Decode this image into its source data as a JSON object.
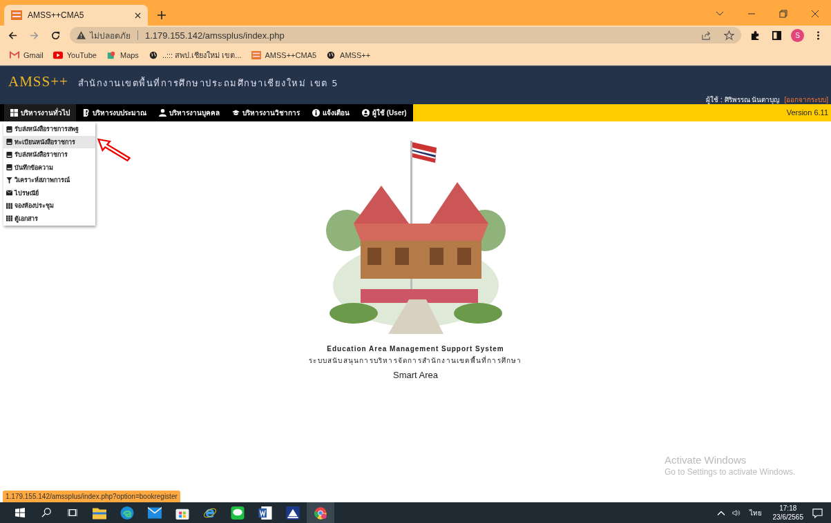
{
  "browser": {
    "tabs": [
      {
        "title": "AMSS++CMA5",
        "selected": true
      }
    ],
    "address": {
      "security": "ไม่ปลอดภัย",
      "url": "1.179.155.142/amssplus/index.php"
    },
    "profile_initial": "S",
    "bookmarks": [
      {
        "kind": "gmail",
        "label": "Gmail"
      },
      {
        "kind": "youtube",
        "label": "YouTube"
      },
      {
        "kind": "maps",
        "label": "Maps"
      },
      {
        "kind": "globe",
        "label": "..::: สพป.เชียงใหม่ เขต..."
      },
      {
        "kind": "amss",
        "label": "AMSS++CMA5"
      },
      {
        "kind": "globe",
        "label": "AMSS++"
      }
    ]
  },
  "header": {
    "logo": "AMSS++",
    "org": "สำนักงานเขตพื้นที่การศึกษาประถมศึกษาเชียงใหม่ เขต 5",
    "user_label": "ผู้ใช้ : ศิริพรรณ นันตาบุญ",
    "logout": "[ออกจากระบบ]"
  },
  "nav": {
    "items": [
      {
        "kind": "grid",
        "label": "บริหารงานทั่วไป",
        "selected": true
      },
      {
        "kind": "bitcoin",
        "label": "บริหารงบประมาณ",
        "selected": false
      },
      {
        "kind": "user",
        "label": "บริหารงานบุคคล",
        "selected": false
      },
      {
        "kind": "cap",
        "label": "บริหารงานวิชาการ",
        "selected": false
      },
      {
        "kind": "info",
        "label": "แจ้งเตือน",
        "selected": false
      },
      {
        "kind": "usercircle",
        "label": "ผู้ใช้ (User)",
        "selected": false
      }
    ],
    "version": "Version 6.11"
  },
  "dropdown": [
    {
      "kind": "book",
      "label": "รับส่งหนังสือราชการสพฐ",
      "selected": false
    },
    {
      "kind": "book",
      "label": "ทะเบียนหนังสือราชการ",
      "selected": true
    },
    {
      "kind": "book",
      "label": "รับส่งหนังสือราชการ",
      "selected": false
    },
    {
      "kind": "book",
      "label": "บันทึกข้อความ",
      "selected": false
    },
    {
      "kind": "filter",
      "label": "วิเคราะห์สภาพการณ์",
      "selected": false
    },
    {
      "kind": "mail",
      "label": "ไปรษณีย์",
      "selected": false
    },
    {
      "kind": "grid",
      "label": "จองห้องประชุม",
      "selected": false
    },
    {
      "kind": "grid",
      "label": "ตู้เอกสาร",
      "selected": false
    }
  ],
  "footer": {
    "title": "Education Area Management Support System",
    "subtitle": "ระบบสนับสนุนการบริหารจัดการสำนักงานเขตพื้นที่การศึกษา",
    "tagline": "Smart Area"
  },
  "status_url": "1.179.155.142/amssplus/index.php?option=bookregister",
  "activation": {
    "title": "Activate Windows",
    "hint": "Go to Settings to activate Windows."
  },
  "taskbar": {
    "apps": [
      {
        "kind": "explorer",
        "selected": false
      },
      {
        "kind": "edge",
        "selected": false
      },
      {
        "kind": "mail",
        "selected": false
      },
      {
        "kind": "store",
        "selected": false
      },
      {
        "kind": "ie",
        "selected": false
      },
      {
        "kind": "line",
        "selected": false
      },
      {
        "kind": "word",
        "selected": false
      },
      {
        "kind": "scan",
        "selected": false
      },
      {
        "kind": "chrome",
        "selected": true
      }
    ],
    "language": "ไทย",
    "time": "17:18",
    "date": "23/6/2565"
  }
}
